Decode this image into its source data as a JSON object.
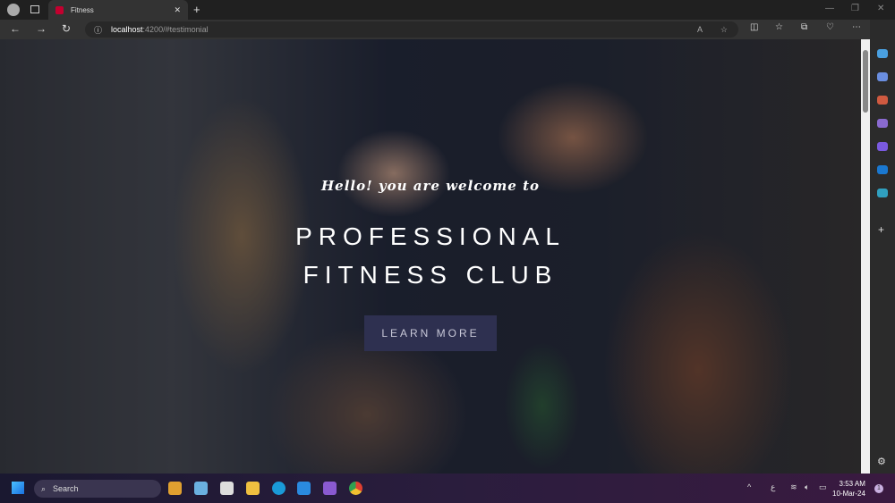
{
  "browser": {
    "tab_title": "Fitness",
    "url_host": "localhost",
    "url_path": ":4200/#testimonial"
  },
  "hero": {
    "greeting": "Hello! you are welcome to",
    "title_line1": "PROFESSIONAL",
    "title_line2": "FITNESS CLUB",
    "cta": "LEARN MORE"
  },
  "taskbar": {
    "search_label": "Search",
    "time": "3:53 AM",
    "date": "10-Mar-24",
    "notification_count": "1",
    "lang": "ع"
  }
}
